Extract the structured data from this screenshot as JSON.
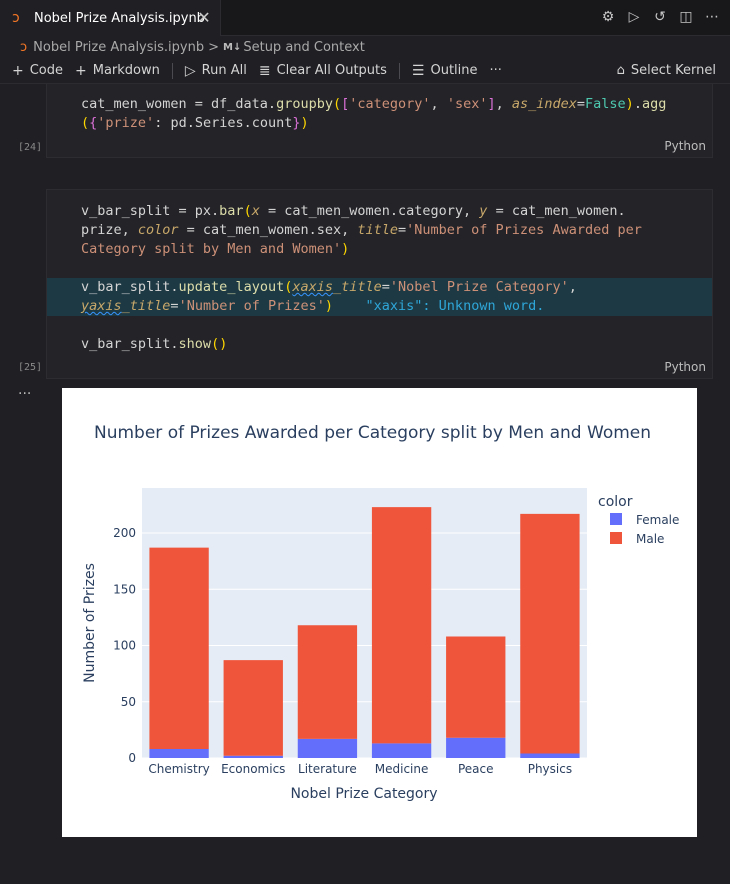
{
  "tab": {
    "title": "Nobel Prize Analysis.ipynb",
    "close": "✕"
  },
  "breadcrumb": {
    "file": "Nobel Prize Analysis.ipynb",
    "separator": ">",
    "md_badge": "M↓",
    "section": "Setup and Context"
  },
  "toolbar": {
    "code": "Code",
    "markdown": "Markdown",
    "run_all": "Run All",
    "clear_outputs": "Clear All Outputs",
    "outline": "Outline",
    "more": "···",
    "kernel": "Select Kernel"
  },
  "cell24": {
    "exec_count": "[24]",
    "language": "Python"
  },
  "cell25": {
    "exec_count": "[25]",
    "language": "Python",
    "diagnostic": "\"xaxis\": Unknown word."
  },
  "output": {
    "more": "···"
  },
  "chart_data": {
    "type": "bar",
    "barmode": "stack",
    "title": "Number of Prizes Awarded per Category split by Men and Women",
    "xlabel": "Nobel Prize Category",
    "ylabel": "Number of Prizes",
    "legend_title": "color",
    "legend_position": "top-right",
    "categories": [
      "Chemistry",
      "Economics",
      "Literature",
      "Medicine",
      "Peace",
      "Physics"
    ],
    "series": [
      {
        "name": "Female",
        "color": "#636efa",
        "values": [
          8,
          2,
          17,
          13,
          18,
          4
        ]
      },
      {
        "name": "Male",
        "color": "#ef553b",
        "values": [
          179,
          85,
          101,
          210,
          90,
          213
        ]
      }
    ],
    "ylim": [
      0,
      240
    ],
    "yticks": [
      0,
      50,
      100,
      150,
      200
    ],
    "grid": true,
    "plot_bg": "#e5ecf6"
  }
}
